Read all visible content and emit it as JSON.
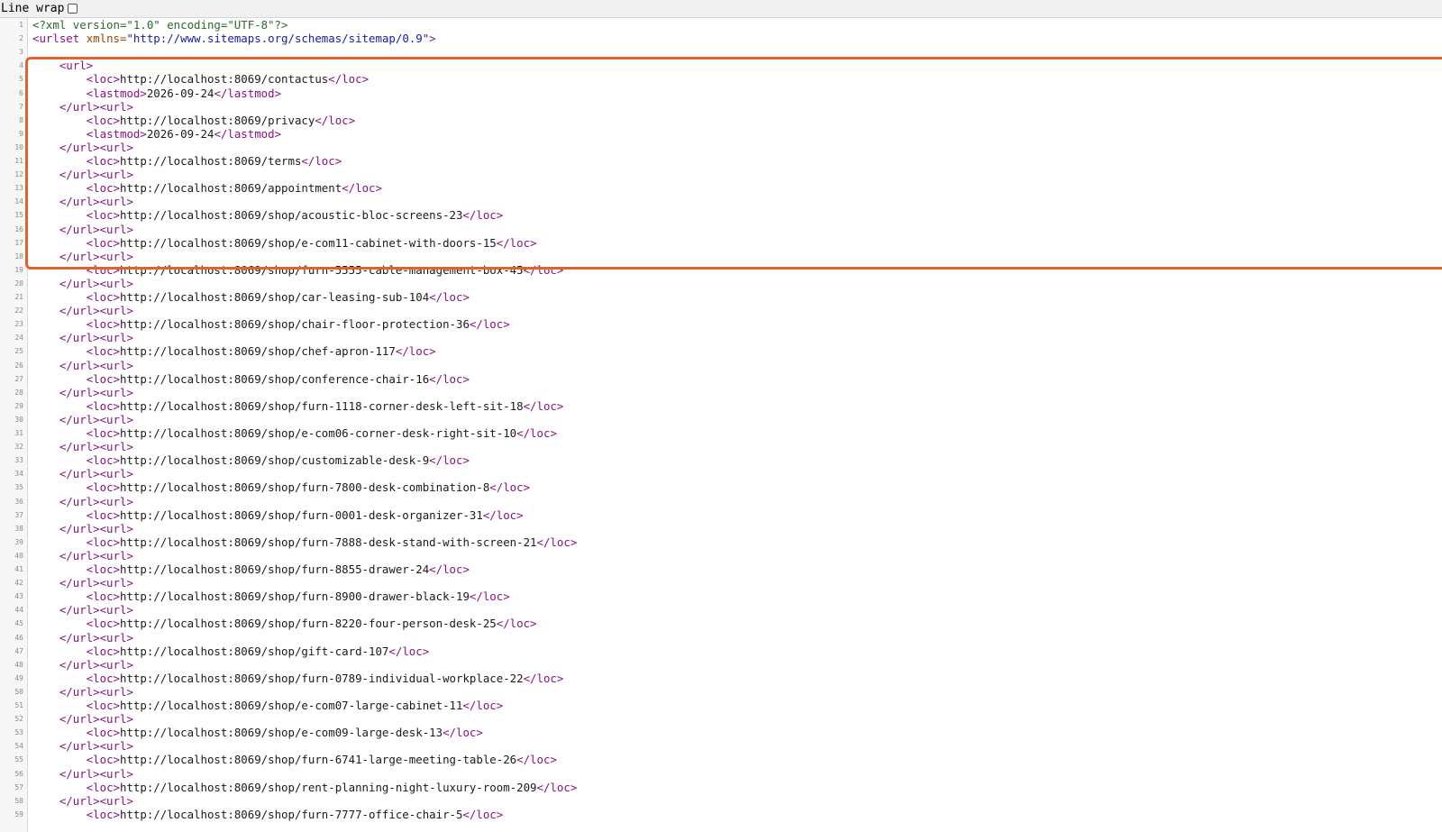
{
  "toolbar": {
    "line_wrap_label": "Line wrap",
    "line_wrap_checked": false
  },
  "colors": {
    "highlight_border": "#e0622c",
    "tag": "#881280",
    "attr": "#994500",
    "value": "#1a1aa6"
  },
  "xml_declaration": "<?xml version=\"1.0\" encoding=\"UTF-8\"?>",
  "urlset_open": {
    "tag_open": "<urlset ",
    "attr_name": "xmlns",
    "attr_eq": "=",
    "attr_value": "\"http://www.sitemaps.org/schemas/sitemap/0.9\"",
    "tag_close": ">"
  },
  "url_open": "<url>",
  "url_separator": "</url><url>",
  "loc_open": "<loc>",
  "loc_close": "</loc>",
  "lastmod_open": "<lastmod>",
  "lastmod_close": "</lastmod>",
  "lastmod_value": "2026-09-24",
  "urls": [
    "http://localhost:8069/contactus",
    "http://localhost:8069/privacy",
    "http://localhost:8069/terms",
    "http://localhost:8069/appointment",
    "http://localhost:8069/shop/acoustic-bloc-screens-23",
    "http://localhost:8069/shop/e-com11-cabinet-with-doors-15",
    "http://localhost:8069/shop/furn-5555-cable-management-box-45",
    "http://localhost:8069/shop/car-leasing-sub-104",
    "http://localhost:8069/shop/chair-floor-protection-36",
    "http://localhost:8069/shop/chef-apron-117",
    "http://localhost:8069/shop/conference-chair-16",
    "http://localhost:8069/shop/furn-1118-corner-desk-left-sit-18",
    "http://localhost:8069/shop/e-com06-corner-desk-right-sit-10",
    "http://localhost:8069/shop/customizable-desk-9",
    "http://localhost:8069/shop/furn-7800-desk-combination-8",
    "http://localhost:8069/shop/furn-0001-desk-organizer-31",
    "http://localhost:8069/shop/furn-7888-desk-stand-with-screen-21",
    "http://localhost:8069/shop/furn-8855-drawer-24",
    "http://localhost:8069/shop/furn-8900-drawer-black-19",
    "http://localhost:8069/shop/furn-8220-four-person-desk-25",
    "http://localhost:8069/shop/gift-card-107",
    "http://localhost:8069/shop/furn-0789-individual-workplace-22",
    "http://localhost:8069/shop/e-com07-large-cabinet-11",
    "http://localhost:8069/shop/e-com09-large-desk-13",
    "http://localhost:8069/shop/furn-6741-large-meeting-table-26",
    "http://localhost:8069/shop/rent-planning-night-luxury-room-209",
    "http://localhost:8069/shop/furn-7777-office-chair-5"
  ],
  "lastmod_url_indices": [
    0,
    1
  ]
}
